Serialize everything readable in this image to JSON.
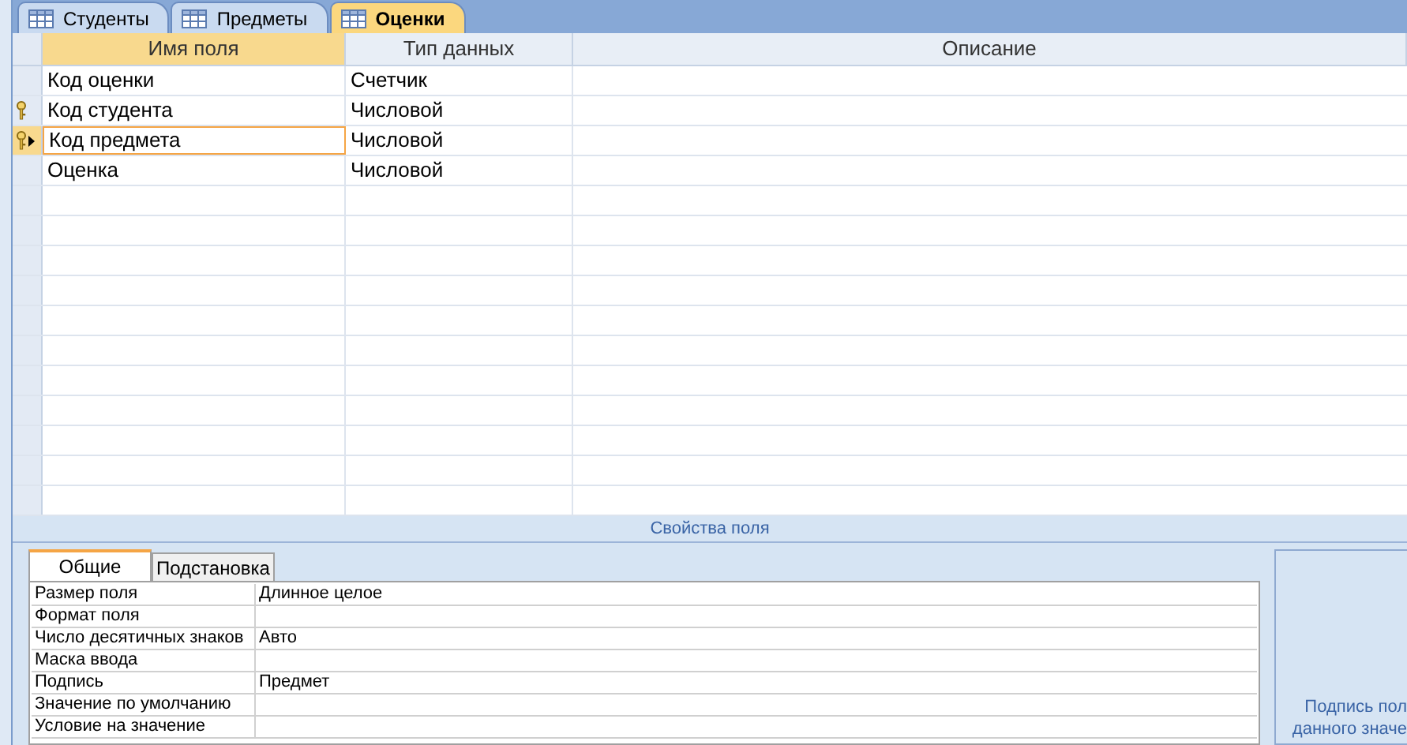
{
  "tabs": [
    {
      "label": "Студенты",
      "selected": false
    },
    {
      "label": "Предметы",
      "selected": false
    },
    {
      "label": "Оценки",
      "selected": true
    }
  ],
  "design_grid": {
    "columns": [
      "Имя поля",
      "Тип данных",
      "Описание"
    ],
    "rows": [
      {
        "field_name": "Код оценки",
        "data_type": "Счетчик",
        "key": false,
        "selected": false
      },
      {
        "field_name": "Код студента",
        "data_type": "Числовой",
        "key": true,
        "selected": false
      },
      {
        "field_name": "Код предмета",
        "data_type": "Числовой",
        "key": true,
        "selected": true
      },
      {
        "field_name": "Оценка",
        "data_type": "Числовой",
        "key": false,
        "selected": false
      }
    ]
  },
  "properties": {
    "title": "Свойства поля",
    "tabs": [
      {
        "label": "Общие",
        "selected": true
      },
      {
        "label": "Подстановка",
        "selected": false
      }
    ],
    "rows": [
      {
        "name": "Размер поля",
        "value": "Длинное целое"
      },
      {
        "name": "Формат поля",
        "value": ""
      },
      {
        "name": "Число десятичных знаков",
        "value": "Авто"
      },
      {
        "name": "Маска ввода",
        "value": ""
      },
      {
        "name": "Подпись",
        "value": "Предмет"
      },
      {
        "name": "Значение по умолчанию",
        "value": ""
      },
      {
        "name": "Условие на значение",
        "value": ""
      }
    ],
    "help_lines": [
      "Подпись пол",
      "данного значе"
    ]
  }
}
